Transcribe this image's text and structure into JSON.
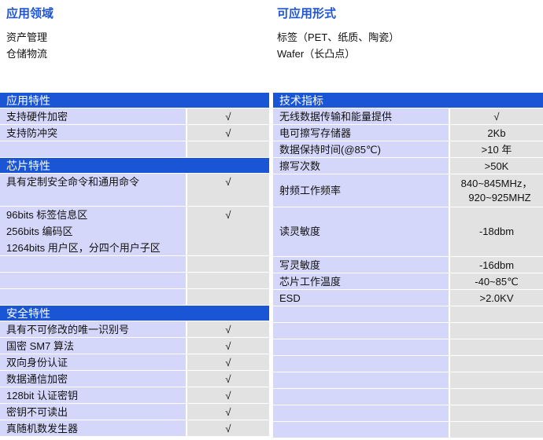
{
  "application_fields": {
    "title": "应用领域",
    "items": [
      "资产管理",
      "仓储物流"
    ]
  },
  "application_forms": {
    "title": "可应用形式",
    "items": [
      "标签（PET、纸质、陶瓷）",
      "Wafer（长凸点）"
    ]
  },
  "app_features": {
    "title": "应用特性",
    "rows": [
      {
        "k": "支持硬件加密",
        "v": "√"
      },
      {
        "k": "支持防冲突",
        "v": "√"
      }
    ]
  },
  "chip_features": {
    "title": "芯片特性",
    "rows": [
      {
        "k": "具有定制安全命令和通用命令",
        "v": "√"
      },
      {
        "k": [
          "96bits 标签信息区",
          "256bits 编码区",
          "1264bits 用户区，分四个用户子区"
        ],
        "v": "√"
      }
    ]
  },
  "security_features": {
    "title": "安全特性",
    "rows": [
      {
        "k": "具有不可修改的唯一识别号",
        "v": "√"
      },
      {
        "k": "国密 SM7 算法",
        "v": "√"
      },
      {
        "k": "双向身份认证",
        "v": "√"
      },
      {
        "k": "数据通信加密",
        "v": "√"
      },
      {
        "k": "128bit 认证密钥",
        "v": "√"
      },
      {
        "k": "密钥不可读出",
        "v": "√"
      },
      {
        "k": "真随机数发生器",
        "v": "√"
      }
    ]
  },
  "tech_specs": {
    "title": "技术指标",
    "rows": [
      {
        "k": "无线数据传输和能量提供",
        "v": "√"
      },
      {
        "k": "电可擦写存储器",
        "v": "2Kb"
      },
      {
        "k": "数据保持时间(@85℃)",
        "v": ">10 年"
      },
      {
        "k": "擦写次数",
        "v": ">50K"
      },
      {
        "k": "射频工作频率",
        "v": [
          "840~845MHz，",
          "920~925MHZ"
        ]
      },
      {
        "k": "读灵敏度",
        "v": "-18dbm"
      },
      {
        "k": "写灵敏度",
        "v": "-16dbm"
      },
      {
        "k": "芯片工作温度",
        "v": "-40~85℃"
      },
      {
        "k": "ESD",
        "v": ">2.0KV"
      }
    ]
  }
}
